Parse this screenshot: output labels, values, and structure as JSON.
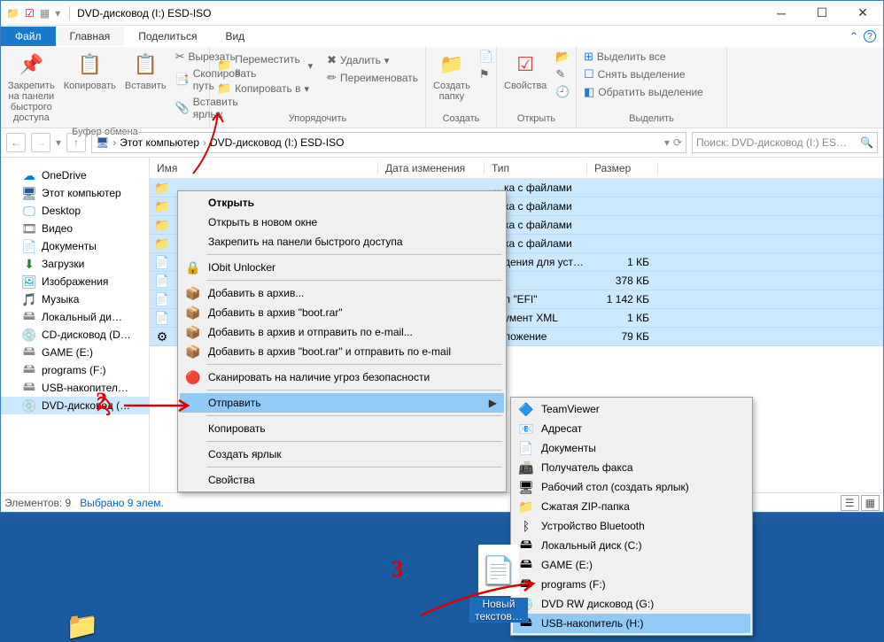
{
  "window": {
    "title": "DVD-дисковод (I:) ESD-ISO"
  },
  "tabs": {
    "file": "Файл",
    "home": "Главная",
    "share": "Поделиться",
    "view": "Вид"
  },
  "ribbon": {
    "clipboard": {
      "pin": "Закрепить на панели\nбыстрого доступа",
      "copy": "Копировать",
      "paste": "Вставить",
      "cut": "Вырезать",
      "copypath": "Скопировать путь",
      "pasteshortcut": "Вставить ярлык",
      "label": "Буфер обмена"
    },
    "organize": {
      "moveto": "Переместить в",
      "copyto": "Копировать в",
      "delete": "Удалить",
      "rename": "Переименовать",
      "label": "Упорядочить"
    },
    "new": {
      "newfolder": "Создать\nпапку",
      "label": "Создать"
    },
    "open": {
      "props": "Свойства",
      "label": "Открыть"
    },
    "select": {
      "selectall": "Выделить все",
      "deselect": "Снять выделение",
      "invert": "Обратить выделение",
      "label": "Выделить"
    }
  },
  "breadcrumbs": {
    "thispc": "Этот компьютер",
    "dvd": "DVD-дисковод (I:) ESD-ISO"
  },
  "search": {
    "placeholder": "Поиск: DVD-дисковод (I:) ES…"
  },
  "columns": {
    "name": "Имя",
    "date": "Дата изменения",
    "type": "Тип",
    "size": "Размер"
  },
  "nav": [
    {
      "icon": "☁",
      "label": "OneDrive",
      "color": "#0078d7"
    },
    {
      "icon": "🖥",
      "label": "Этот компьютер",
      "color": "#2b579a"
    },
    {
      "icon": "🖵",
      "label": "Desktop",
      "color": "#3aa0da"
    },
    {
      "icon": "🎞",
      "label": "Видео",
      "color": "#666"
    },
    {
      "icon": "📄",
      "label": "Документы",
      "color": "#555"
    },
    {
      "icon": "⬇",
      "label": "Загрузки",
      "color": "#2e7d32"
    },
    {
      "icon": "🖼",
      "label": "Изображения",
      "color": "#18a0b0"
    },
    {
      "icon": "🎵",
      "label": "Музыка",
      "color": "#0078d7"
    },
    {
      "icon": "🖴",
      "label": "Локальный ди…",
      "color": "#888"
    },
    {
      "icon": "💿",
      "label": "CD-дисковод (D…",
      "color": "#888"
    },
    {
      "icon": "🖴",
      "label": "GAME (E:)",
      "color": "#888"
    },
    {
      "icon": "🖴",
      "label": "programs (F:)",
      "color": "#888"
    },
    {
      "icon": "🖴",
      "label": "USB-накопител…",
      "color": "#888"
    },
    {
      "icon": "💿",
      "label": "DVD-дисковод (…",
      "color": "#5a9e2d",
      "selected": true
    }
  ],
  "rows": [
    {
      "icon": "📁",
      "type_vis": "…ка с файлами",
      "size": ""
    },
    {
      "icon": "📁",
      "type_vis": "…ка с файлами",
      "size": ""
    },
    {
      "icon": "📁",
      "type_vis": "…ка с файлами",
      "size": ""
    },
    {
      "icon": "📁",
      "type_vis": "…ка с файлами",
      "size": ""
    },
    {
      "icon": "📄",
      "type_vis": "…дения для уст…",
      "size": "1 КБ"
    },
    {
      "icon": "📄",
      "type_vis": "…",
      "size": "378 КБ"
    },
    {
      "icon": "📄",
      "type_vis": "…л \"EFI\"",
      "size": "1 142 КБ"
    },
    {
      "icon": "📄",
      "type_vis": "…умент XML",
      "size": "1 КБ"
    },
    {
      "icon": "⚙",
      "type_vis": "…ложение",
      "size": "79 КБ"
    }
  ],
  "status": {
    "count": "Элементов: 9",
    "selected": "Выбрано 9 элем."
  },
  "ctx1": [
    {
      "label": "Открыть",
      "bold": true
    },
    {
      "label": "Открыть в новом окне"
    },
    {
      "label": "Закрепить на панели быстрого доступа"
    },
    {
      "sep": true
    },
    {
      "label": "IObit Unlocker",
      "icon": "🔒"
    },
    {
      "sep": true
    },
    {
      "label": "Добавить в архив...",
      "icon": "📦"
    },
    {
      "label": "Добавить в архив \"boot.rar\"",
      "icon": "📦"
    },
    {
      "label": "Добавить в архив и отправить по e-mail...",
      "icon": "📦"
    },
    {
      "label": "Добавить в архив \"boot.rar\" и отправить по e-mail",
      "icon": "📦"
    },
    {
      "sep": true
    },
    {
      "label": "Сканировать на наличие угроз безопасности",
      "icon": "🔴"
    },
    {
      "sep": true
    },
    {
      "label": "Отправить",
      "sub": true,
      "hl": true
    },
    {
      "sep": true
    },
    {
      "label": "Копировать"
    },
    {
      "sep": true
    },
    {
      "label": "Создать ярлык"
    },
    {
      "sep": true
    },
    {
      "label": "Свойства"
    }
  ],
  "ctx2": [
    {
      "label": "TeamViewer",
      "icon": "🔷"
    },
    {
      "label": "Адресат",
      "icon": "📧"
    },
    {
      "label": "Документы",
      "icon": "📄"
    },
    {
      "label": "Получатель факса",
      "icon": "📠"
    },
    {
      "label": "Рабочий стол (создать ярлык)",
      "icon": "🖥"
    },
    {
      "label": "Сжатая ZIP-папка",
      "icon": "📁"
    },
    {
      "label": "Устройство Bluetooth",
      "icon": "ᛒ"
    },
    {
      "label": "Локальный диск (C:)",
      "icon": "🖴"
    },
    {
      "label": "GAME (E:)",
      "icon": "🖴"
    },
    {
      "label": "programs (F:)",
      "icon": "🖴"
    },
    {
      "label": "DVD RW дисковод (G:)",
      "icon": "💿"
    },
    {
      "label": "USB-накопитель (H:)",
      "icon": "🖴",
      "hl": true
    }
  ],
  "desktop": {
    "newtext": "Новый\nтекстов…"
  },
  "annotations": {
    "a2": "2",
    "a3": "3"
  }
}
